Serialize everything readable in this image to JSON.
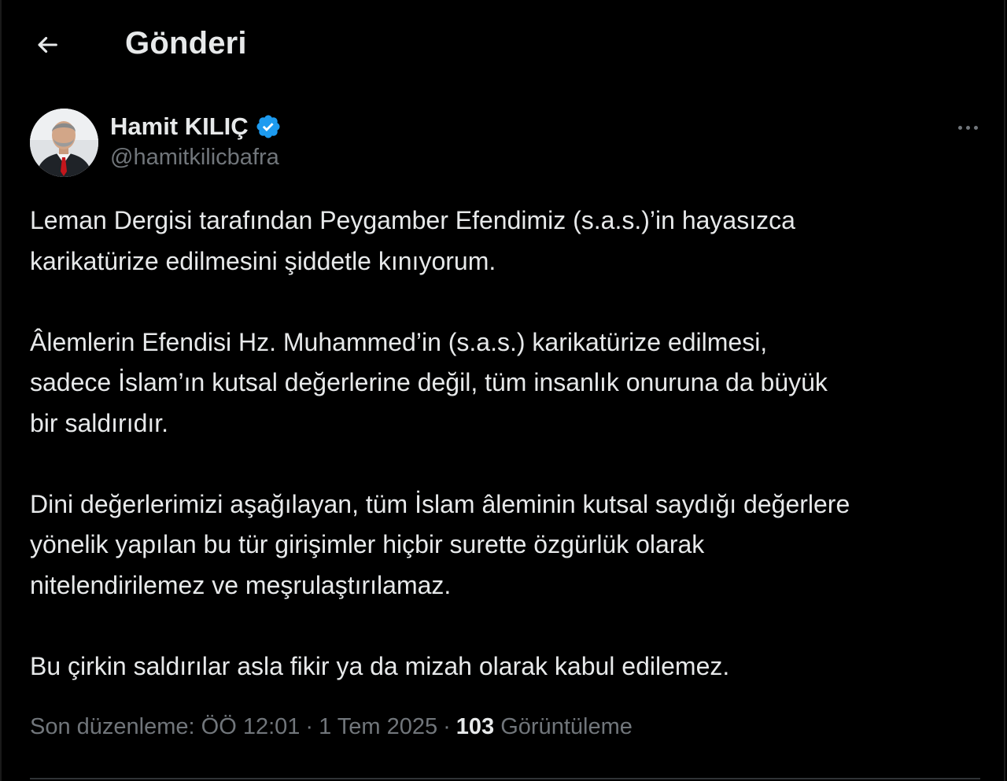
{
  "header": {
    "title": "Gönderi"
  },
  "author": {
    "name": "Hamit KILIÇ",
    "handle": "@hamitkilicbafra",
    "verified": true
  },
  "tweet": {
    "paragraphs": [
      "Leman Dergisi tarafından Peygamber Efendimiz (s.a.s.)’in hayasızca\nkarikatürize edilmesini şiddetle kınıyorum.",
      "Âlemlerin Efendisi Hz. Muhammed’in (s.a.s.) karikatürize edilmesi,\nsadece İslam’ın kutsal değerlerine değil, tüm insanlık onuruna da büyük\nbir saldırıdır.",
      "Dini değerlerimizi aşağılayan, tüm İslam âleminin kutsal saydığı değerlere\nyönelik yapılan bu tür girişimler hiçbir surette özgürlük olarak\nnitelendirilemez ve meşrulaştırılamaz.",
      "Bu çirkin saldırılar asla fikir ya da mizah olarak kabul edilemez."
    ]
  },
  "meta": {
    "edited_label": "Son düzenleme: ÖÖ 12:01",
    "date": "1 Tem 2025",
    "separator": "·",
    "views_count": "103",
    "views_label": "Görüntüleme"
  },
  "colors": {
    "background": "#000000",
    "text_primary": "#e7e9ea",
    "text_secondary": "#71767b",
    "verified_blue": "#1d9bf0",
    "divider": "#2f3336"
  },
  "icons": {
    "back": "arrow-left-icon",
    "verified": "verified-badge-icon",
    "more": "more-horizontal-icon"
  }
}
